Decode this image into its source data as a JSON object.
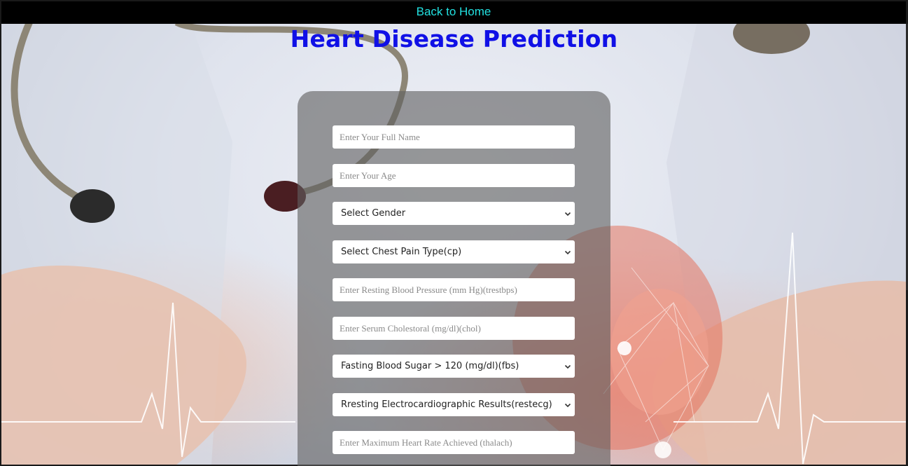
{
  "nav": {
    "back_link": "Back to Home"
  },
  "page": {
    "title": "Heart Disease Prediction"
  },
  "form": {
    "name_placeholder": "Enter Your Full Name",
    "age_placeholder": "Enter Your Age",
    "gender_selected": "Select Gender",
    "chest_pain_selected": "Select Chest Pain Type(cp)",
    "bp_placeholder": "Enter Resting Blood Pressure (mm Hg)(trestbps)",
    "chol_placeholder": "Enter Serum Cholestoral (mg/dl)(chol)",
    "fbs_selected": "Fasting Blood Sugar > 120 (mg/dl)(fbs)",
    "restecg_selected": "Rresting Electrocardiographic Results(restecg)",
    "thalach_placeholder": "Enter Maximum Heart Rate Achieved (thalach)"
  },
  "icons": {
    "dropdown": "chevron-down-icon"
  },
  "colors": {
    "title": "#1010e6",
    "link": "#22e0e0",
    "topbar": "#000000",
    "card": "rgba(95,95,95,0.62)"
  }
}
